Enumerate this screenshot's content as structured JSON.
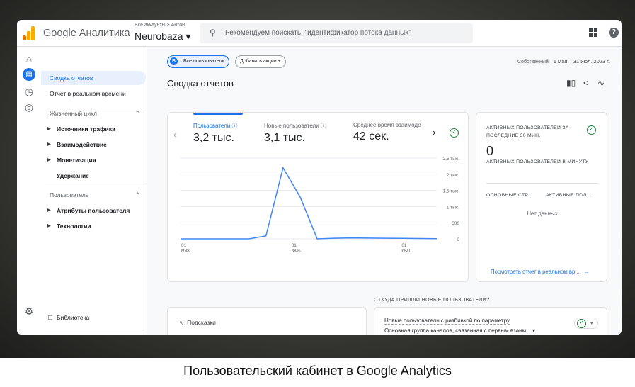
{
  "header": {
    "brand": "Google Аналитика",
    "account_path": "Все аккаунты > Антон",
    "account_name": "Neurobaza ▾",
    "search_placeholder": "Рекомендуем поискать: \"идентификатор потока данных\""
  },
  "nav": {
    "items": [
      {
        "label": "Сводка отчетов",
        "selected": true
      },
      {
        "label": "Отчет в реальном времени"
      },
      {
        "label": "Жизненный цикл",
        "section": true
      },
      {
        "label": "Источники трафика",
        "expandable": true
      },
      {
        "label": "Взаимодействие",
        "expandable": true
      },
      {
        "label": "Монетизация",
        "expandable": true
      },
      {
        "label": "Удержание"
      },
      {
        "label": "Пользователь",
        "section": true
      },
      {
        "label": "Атрибуты пользователя",
        "expandable": true
      },
      {
        "label": "Технологии",
        "expandable": true
      }
    ],
    "library": "Библиотека"
  },
  "main": {
    "segment_chip": "Все пользователи",
    "segment_letter": "В",
    "add_compare": "Добавить акции +",
    "date_tag": "Собственный",
    "date_range": "1 мая – 31 июл. 2023 г.",
    "title": "Сводка отчетов"
  },
  "metrics": [
    {
      "label": "Пользователи ⓘ",
      "value": "3,2 тыс.",
      "active": true
    },
    {
      "label": "Новые пользователи ⓘ",
      "value": "3,1 тыс."
    },
    {
      "label": "Среднее время взаимоде",
      "value": "42 сек."
    }
  ],
  "chart_data": {
    "type": "line",
    "series": [
      {
        "values": [
          0,
          0,
          0,
          0,
          0,
          90,
          2200,
          1300,
          0,
          20,
          30,
          25,
          20,
          15,
          10,
          5
        ]
      }
    ],
    "x_tick_labels": [
      [
        "01",
        "мая"
      ],
      [
        "01",
        "июн."
      ],
      [
        "01",
        "июл."
      ]
    ],
    "y_tick_labels": [
      "0",
      "500",
      "1 тыс.",
      "1,5 тыс.",
      "2 тыс.",
      "2,5 тыс."
    ],
    "ylim": [
      0,
      2500
    ],
    "color": "#4285f4",
    "grid": true
  },
  "realtime": {
    "title": "АКТИВНЫХ ПОЛЬЗОВАТЕЛЕЙ ЗА ПОСЛЕДНИЕ 30 МИН.",
    "count": "0",
    "subtitle": "АКТИВНЫХ ПОЛЬЗОВАТЕЛЕЙ В МИНУТУ",
    "col1": "ОСНОВНЫЕ СТР...",
    "col2": "АКТИВНЫЕ ПОЛ...",
    "nodata": "Нет данных",
    "link": "Посмотреть отчет в реальном вр...",
    "link_arrow": "→"
  },
  "tips": {
    "label": "Подсказки"
  },
  "sources": {
    "heading": "ОТКУДА ПРИШЛИ НОВЫЕ ПОЛЬЗОВАТЕЛИ?",
    "line1": "Новые пользователи с разбивкой по параметру",
    "line2": "Основная группа каналов, связанная с первым взаим... ▾"
  },
  "caption": "Пользовательский кабинет в Google Analytics",
  "colors": {
    "accent": "#1a73e8",
    "success": "#188038",
    "logo_orange": "#f9ab00",
    "logo_dark": "#e37400"
  }
}
